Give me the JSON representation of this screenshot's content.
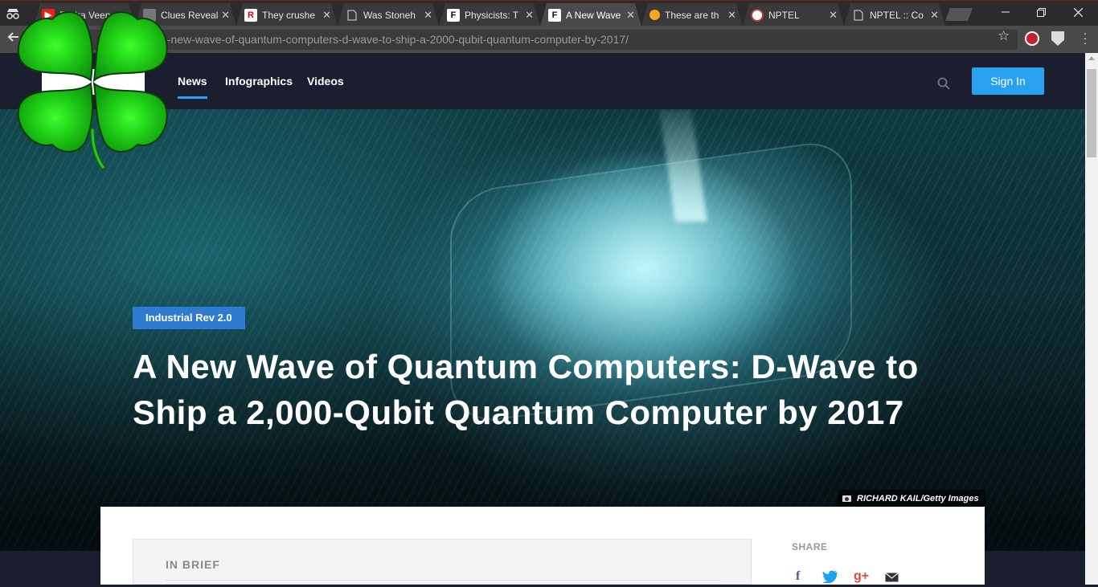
{
  "browser": {
    "tabs": [
      {
        "title": "Rudra Veena",
        "icon": "youtube-icon"
      },
      {
        "title": "Clues Reveal",
        "icon": "page-icon"
      },
      {
        "title": "They crushe",
        "icon": "r-icon"
      },
      {
        "title": "Was Stoneh",
        "icon": "page-icon"
      },
      {
        "title": "Physicists: T",
        "icon": "f-icon"
      },
      {
        "title": "A New Wave",
        "icon": "f-icon",
        "active": true
      },
      {
        "title": "These are th",
        "icon": "circle-icon"
      },
      {
        "title": "NPTEL",
        "icon": "nptel-icon"
      },
      {
        "title": "NPTEL :: Co",
        "icon": "page-icon"
      }
    ],
    "url": "a-new-wave-of-quantum-computers-d-wave-to-ship-a-2000-qubit-quantum-computer-by-2017/",
    "close_glyph": "✕"
  },
  "site": {
    "nav": [
      "News",
      "Infographics",
      "Videos"
    ],
    "active_nav": "News",
    "sign_in": "Sign In",
    "accent": "#2aa1f0"
  },
  "article": {
    "tag": "Industrial Rev 2.0",
    "title": "A New Wave of Quantum Computers: D-Wave to Ship a 2,000-Qubit Quantum Computer by 2017",
    "image_credit": "RICHARD KAIL/Getty Images",
    "brief_label": "IN BRIEF",
    "share_label": "SHARE",
    "share_icons": [
      "f",
      "t",
      "g+",
      "mail"
    ]
  }
}
